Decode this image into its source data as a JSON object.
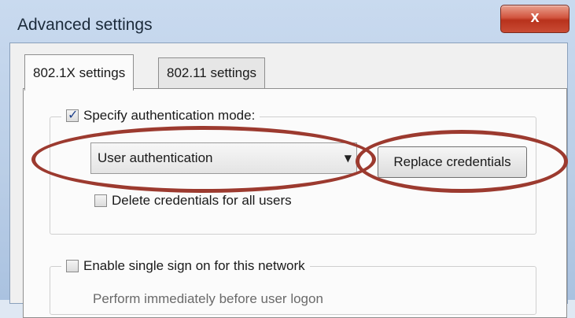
{
  "window": {
    "title": "Advanced settings",
    "close_glyph": "x"
  },
  "tabs": [
    {
      "label": "802.1X settings",
      "active": true
    },
    {
      "label": "802.11 settings",
      "active": false
    }
  ],
  "auth_group": {
    "checkbox_label": "Specify authentication mode:",
    "checked": true,
    "mode_value": "User authentication",
    "replace_button": "Replace credentials",
    "delete_label": "Delete credentials for all users",
    "delete_checked": false
  },
  "sso_group": {
    "checkbox_label": "Enable single sign on for this network",
    "checked": false,
    "option_partial": "Perform immediately before user logon"
  },
  "annotation_color": "#9c3a2f"
}
